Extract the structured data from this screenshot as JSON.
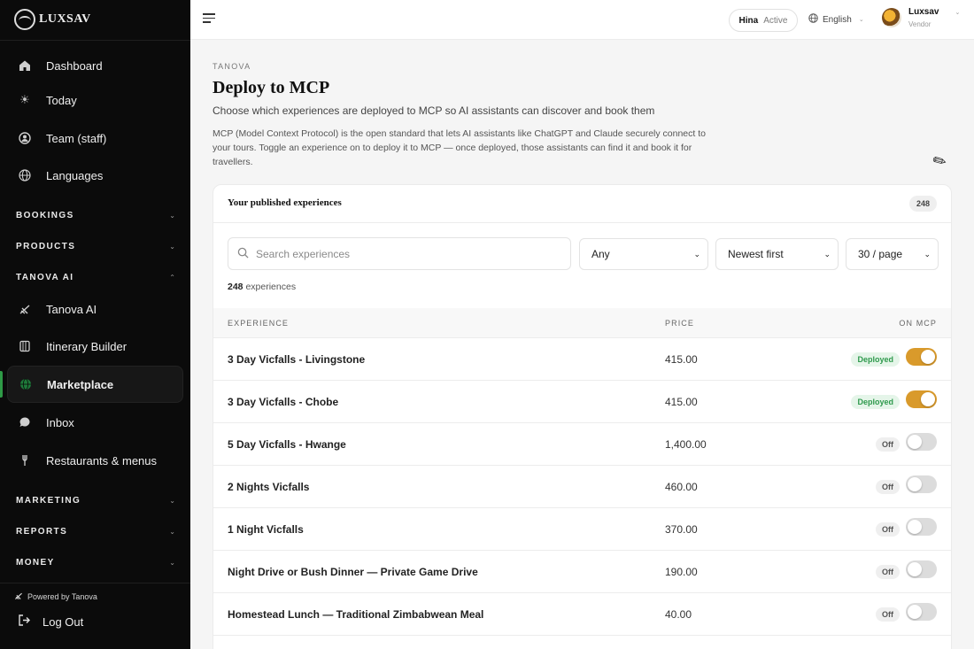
{
  "brand": {
    "name": "LUXSAV",
    "accent": "#d99a2b",
    "active_indicator": "#2e9a46"
  },
  "sidebar": {
    "items_top": [
      {
        "label": "Dashboard",
        "icon": "home-icon"
      },
      {
        "label": "Today",
        "icon": "sun-icon"
      },
      {
        "label": "Team (staff)",
        "icon": "team-icon"
      },
      {
        "label": "Languages",
        "icon": "globe-icon"
      }
    ],
    "sections": {
      "bookings": "BOOKINGS",
      "products": "PRODUCTS",
      "tanova_ai": "TANOVA AI",
      "marketing": "MARKETING",
      "reports": "REPORTS",
      "money": "MONEY"
    },
    "ai_items": [
      {
        "label": "Tanova AI",
        "icon": "quill-icon"
      },
      {
        "label": "Itinerary Builder",
        "icon": "itinerary-icon"
      },
      {
        "label": "Marketplace",
        "icon": "globe-icon",
        "active": true
      },
      {
        "label": "Inbox",
        "icon": "chat-icon"
      },
      {
        "label": "Restaurants & menus",
        "icon": "fork-icon"
      }
    ],
    "powered_by": "Powered by Tanova",
    "logout": "Log Out"
  },
  "topbar": {
    "status_name": "Hina",
    "status_state": "Active",
    "language": "English",
    "user_name": "Luxsav",
    "user_role": "Vendor"
  },
  "page": {
    "eyebrow": "TANOVA",
    "title": "Deploy to MCP",
    "subtitle": "Choose which experiences are deployed to MCP so AI assistants can discover and book them",
    "description": "MCP (Model Context Protocol) is the open standard that lets AI assistants like ChatGPT and Claude securely connect to your tours. Toggle an experience on to deploy it to MCP — once deployed, those assistants can find it and book it for travellers."
  },
  "card": {
    "title": "Your published experiences",
    "count": "248",
    "search_placeholder": "Search experiences",
    "filter_value": "Any",
    "sort_value": "Newest first",
    "per_page_value": "30 / page",
    "results_number": "248",
    "results_suffix": "experiences",
    "columns": {
      "experience": "EXPERIENCE",
      "price": "PRICE",
      "on_mcp": "ON MCP"
    }
  },
  "rows": [
    {
      "name": "3 Day Vicfalls - Livingstone",
      "price": "415.00",
      "status": "Deployed",
      "on": true
    },
    {
      "name": "3 Day Vicfalls - Chobe",
      "price": "415.00",
      "status": "Deployed",
      "on": true
    },
    {
      "name": "5 Day Vicfalls - Hwange",
      "price": "1,400.00",
      "status": "Off",
      "on": false
    },
    {
      "name": "2 Nights Vicfalls",
      "price": "460.00",
      "status": "Off",
      "on": false
    },
    {
      "name": "1 Night Vicfalls",
      "price": "370.00",
      "status": "Off",
      "on": false
    },
    {
      "name": "Night Drive or Bush Dinner — Private Game Drive",
      "price": "190.00",
      "status": "Off",
      "on": false
    },
    {
      "name": "Homestead Lunch — Traditional Zimbabwean Meal",
      "price": "40.00",
      "status": "Off",
      "on": false
    }
  ]
}
